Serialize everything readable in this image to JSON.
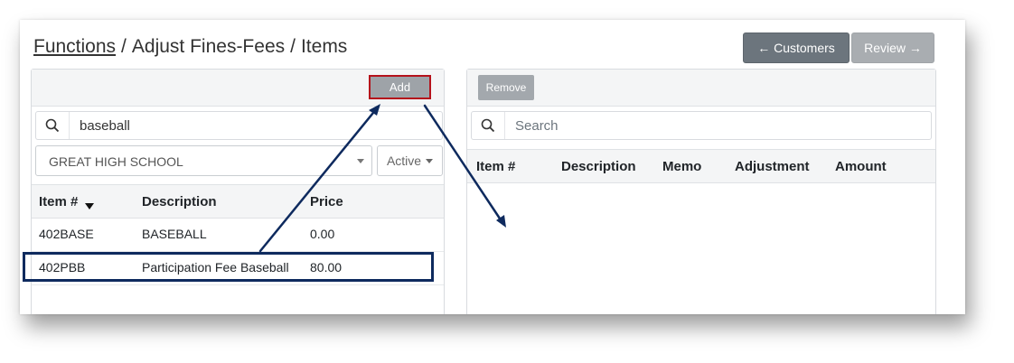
{
  "breadcrumb": {
    "root": "Functions",
    "sep1": "/",
    "section": "Adjust Fines-Fees",
    "sep2": "/",
    "page": "Items"
  },
  "nav": {
    "customers_label": "← Customers",
    "review_label": "Review →"
  },
  "left_panel": {
    "add_label": "Add",
    "search": {
      "value": "baseball",
      "icon": "search-icon"
    },
    "school_select": {
      "value": "GREAT HIGH SCHOOL"
    },
    "status_dropdown": {
      "value": "Active"
    },
    "columns": {
      "item": "Item #",
      "description": "Description",
      "price": "Price"
    },
    "rows": [
      {
        "item": "402BASE",
        "description": "BASEBALL",
        "price": "0.00"
      },
      {
        "item": "402PBB",
        "description": "Participation Fee Baseball",
        "price": "80.00"
      }
    ]
  },
  "right_panel": {
    "remove_label": "Remove",
    "search": {
      "placeholder": "Search",
      "icon": "search-icon"
    },
    "columns": {
      "item": "Item #",
      "description": "Description",
      "memo": "Memo",
      "adjustment": "Adjustment",
      "amount": "Amount"
    }
  },
  "colors": {
    "annotation": "#0e2a5e",
    "add_highlight": "#b5121b"
  }
}
